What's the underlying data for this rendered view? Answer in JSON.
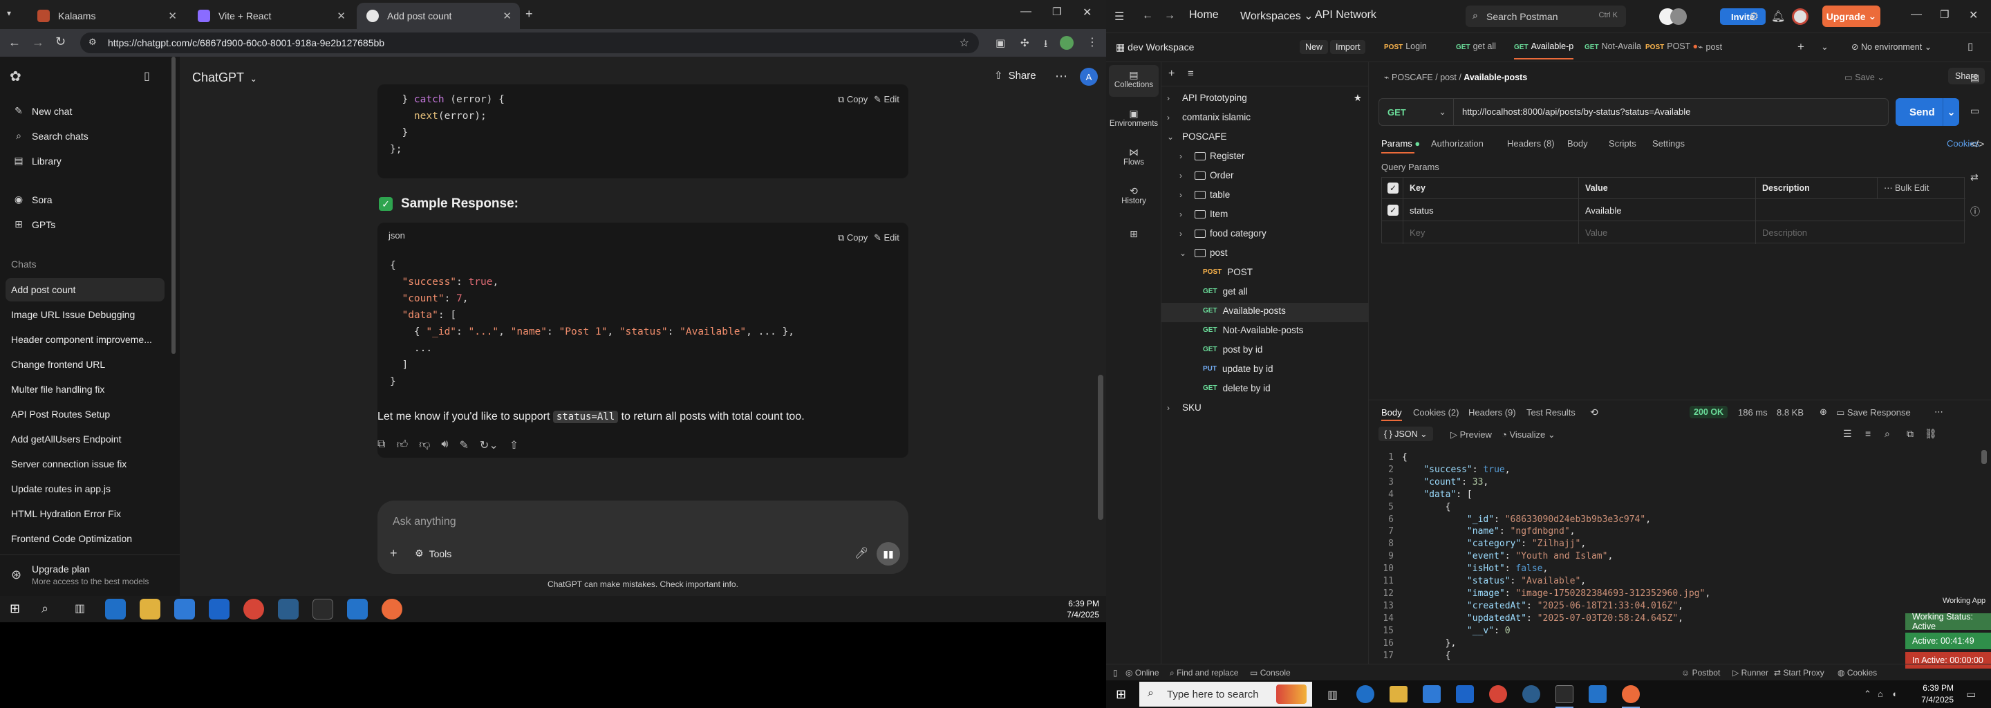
{
  "chrome": {
    "tabs": [
      {
        "title": "Kalaams",
        "color": "#b84a2e"
      },
      {
        "title": "Vite + React",
        "color": "#8a6cff"
      },
      {
        "title": "Add post count",
        "color": "#e6e6e6"
      }
    ],
    "url": "https://chatgpt.com/c/6867d900-60c0-8001-918a-9e2b127685bb"
  },
  "chatgpt": {
    "sidebar": {
      "top": [
        "New chat",
        "Search chats",
        "Library"
      ],
      "apps": [
        "Sora",
        "GPTs"
      ],
      "section": "Chats",
      "chats": [
        "Add post count",
        "Image URL Issue Debugging",
        "Header component improveme...",
        "Change frontend URL",
        "Multer file handling fix",
        "API Post Routes Setup",
        "Add getAllUsers Endpoint",
        "Server connection issue fix",
        "Update routes in app.js",
        "HTML Hydration Error Fix",
        "Frontend Code Optimization"
      ],
      "upgrade_title": "Upgrade plan",
      "upgrade_sub": "More access to the best models"
    },
    "header": {
      "model": "ChatGPT",
      "share": "Share",
      "avatar": "A"
    },
    "code_actions": {
      "copy": "Copy",
      "edit": "Edit"
    },
    "code1_lines": [
      "  } catch (error) {",
      "    next(error);",
      "  }",
      "};"
    ],
    "sample_heading": "Sample Response:",
    "code2_lang": "json",
    "response_text_before": "Let me know if you'd like to support ",
    "response_code": "status=All",
    "response_text_after": " to return all posts with total count too.",
    "composer_placeholder": "Ask anything",
    "tools_label": "Tools",
    "disclaimer": "ChatGPT can make mistakes. Check important info."
  },
  "taskbar_left": {
    "time": "6:39 PM",
    "date": "7/4/2025"
  },
  "postman": {
    "nav": {
      "home": "Home",
      "workspaces": "Workspaces",
      "api_network": "API Network"
    },
    "search_placeholder": "Search Postman",
    "search_shortcut": "Ctrl K",
    "invite": "Invite",
    "upgrade": "Upgrade",
    "workspace": "dev Workspace",
    "new": "New",
    "import": "Import",
    "tabs": [
      {
        "method": "POST",
        "name": "Login",
        "cls": "mpost"
      },
      {
        "method": "GET",
        "name": "get all",
        "cls": "mget"
      },
      {
        "method": "GET",
        "name": "Available-p",
        "cls": "mget"
      },
      {
        "method": "GET",
        "name": "Not-Availa",
        "cls": "mget"
      },
      {
        "method": "POST",
        "name": "POST",
        "cls": "mpost"
      },
      {
        "method": "",
        "name": "post",
        "cls": ""
      }
    ],
    "env": "No environment",
    "rail": [
      "Collections",
      "Environments",
      "Flows",
      "History"
    ],
    "tree": {
      "collections": [
        "API Prototyping",
        "comtanix islamic",
        "POSCAFE"
      ],
      "folders": [
        "Register",
        "Order",
        "table",
        "Item",
        "food category",
        "post"
      ],
      "requests": [
        {
          "method": "POST",
          "name": "POST",
          "cls": "mpost"
        },
        {
          "method": "GET",
          "name": "get all",
          "cls": "mget"
        },
        {
          "method": "GET",
          "name": "Available-posts",
          "cls": "mget"
        },
        {
          "method": "GET",
          "name": "Not-Available-posts",
          "cls": "mget"
        },
        {
          "method": "GET",
          "name": "post by id",
          "cls": "mget"
        },
        {
          "method": "PUT",
          "name": "update by id",
          "cls": "mput"
        },
        {
          "method": "GET",
          "name": "delete by id",
          "cls": "mget"
        }
      ],
      "sku": "SKU"
    },
    "breadcrumb": {
      "a": "POSCAFE",
      "b": "post",
      "c": "Available-posts"
    },
    "save": "Save",
    "share": "Share",
    "method": "GET",
    "url": "http://localhost:8000/api/posts/by-status?status=Available",
    "send": "Send",
    "req_tabs": [
      "Params",
      "Authorization",
      "Headers (8)",
      "Body",
      "Scripts",
      "Settings"
    ],
    "cookies": "Cookies",
    "query_params": "Query Params",
    "table_headers": [
      "Key",
      "Value",
      "Description"
    ],
    "bulk_edit": "Bulk Edit",
    "param_row": {
      "key": "status",
      "value": "Available"
    },
    "placeholders": {
      "key": "Key",
      "value": "Value",
      "description": "Description"
    },
    "resp_tabs": [
      "Body",
      "Cookies (2)",
      "Headers (9)",
      "Test Results"
    ],
    "resp_status": "200 OK",
    "resp_time": "186 ms",
    "resp_size": "8.8 KB",
    "save_response": "Save Response",
    "format": "JSON",
    "preview": "Preview",
    "visualize": "Visualize",
    "status_bar": [
      "Online",
      "Find and replace",
      "Console",
      "Postbot",
      "Runner",
      "Start Proxy",
      "Cookies"
    ],
    "working_app": "Working App",
    "working_status": "Working Status: Active",
    "active_time": "Active: 00:41:49",
    "inactive_time": "In Active: 00:00:00"
  },
  "taskbar_right": {
    "search": "Type here to search",
    "time": "6:39 PM",
    "date": "7/4/2025"
  }
}
